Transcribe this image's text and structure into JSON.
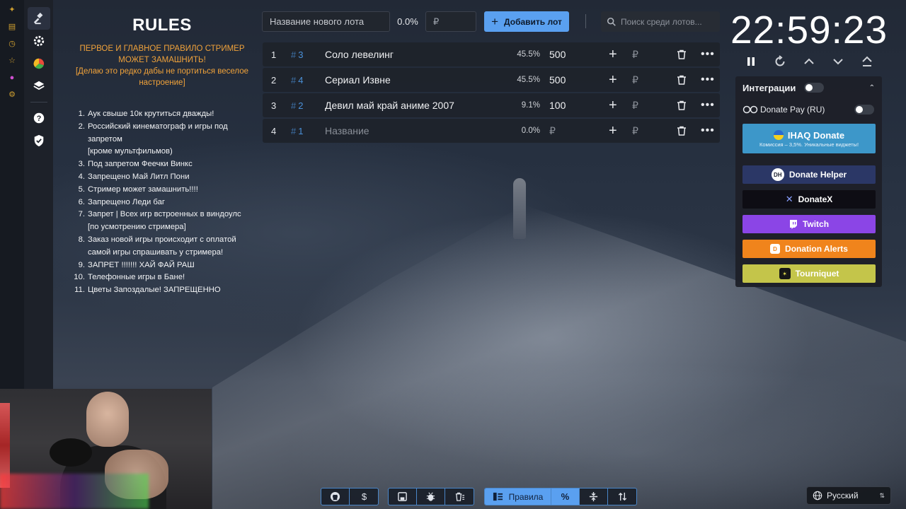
{
  "rules": {
    "title": "RULES",
    "subtitle_1": "ПЕРВОЕ И ГЛАВНОЕ ПРАВИЛО СТРИМЕР МОЖЕТ ЗАМАШНИТЬ!",
    "subtitle_2": "[Делаю это редко дабы не портиться веселое настроение]",
    "items": [
      {
        "num": "1.",
        "text": "Аук свыше 10к крутиться дважды!"
      },
      {
        "num": "2.",
        "text": "Российский кинематограф и игры  под запретом\n[кроме мультфильмов)"
      },
      {
        "num": "3.",
        "text": "Под запретом Феечки Винкс"
      },
      {
        "num": "4.",
        "text": "Запрещено Май Литл Пони"
      },
      {
        "num": "5.",
        "text": "Стример может замашнить!!!!"
      },
      {
        "num": "6.",
        "text": "Запрещено Леди баг"
      },
      {
        "num": "7.",
        "text": "Запрет | Всех игр встроенных в виндоулс\n[по усмотрению стримера]"
      },
      {
        "num": "8.",
        "text": "Заказ новой игры происходит с оплатой самой игры спрашивать у стримера!"
      },
      {
        "num": "9.",
        "text": "ЗАПРЕТ !!!!!!! ХАЙ ФАЙ РАШ"
      },
      {
        "num": "10.",
        "text": "Телефонные игры в Бане!"
      },
      {
        "num": "11.",
        "text": "Цветы Запоздалые! ЗАПРЕЩЕННО"
      }
    ]
  },
  "add_lot": {
    "name_placeholder": "Название нового лота",
    "percent": "0.0%",
    "amount_placeholder": "₽",
    "button_label": "Добавить лот"
  },
  "search": {
    "placeholder": "Поиск среди лотов..."
  },
  "lots": [
    {
      "index": "1",
      "id": "3",
      "name": "Соло левелинг",
      "percent": "45.5%",
      "amount": "500",
      "currency": "₽"
    },
    {
      "index": "2",
      "id": "4",
      "name": "Сериал Извне",
      "percent": "45.5%",
      "amount": "500",
      "currency": "₽"
    },
    {
      "index": "3",
      "id": "2",
      "name": "Девил май край аниме 2007",
      "percent": "9.1%",
      "amount": "100",
      "currency": "₽"
    },
    {
      "index": "4",
      "id": "1",
      "name": "Название",
      "percent": "0.0%",
      "amount": "₽",
      "currency": "₽",
      "placeholder": true
    }
  ],
  "timer": {
    "value": "22:59:23"
  },
  "integrations": {
    "title": "Интеграции",
    "donate_pay": "Donate Pay (RU)",
    "ihaq_label": "IHAQ Donate",
    "ihaq_sub": "Комиссия – 3,5%. Уникальные виджеты!",
    "donate_helper": "Donate Helper",
    "donatex": "DonateX",
    "twitch": "Twitch",
    "donation_alerts": "Donation Alerts",
    "tourniquet": "Tourniquet",
    "colors": {
      "ihaq": "#3d97c9",
      "donate_helper": "#2b3766",
      "donatex": "#0e0d14",
      "twitch": "#8b45e6",
      "donation_alerts": "#f0841c",
      "tourniquet": "#c4c54a"
    }
  },
  "bottom": {
    "rules_label": "Правила"
  },
  "language": {
    "selected": "Русский"
  },
  "accent_color": "#5aa0f0"
}
